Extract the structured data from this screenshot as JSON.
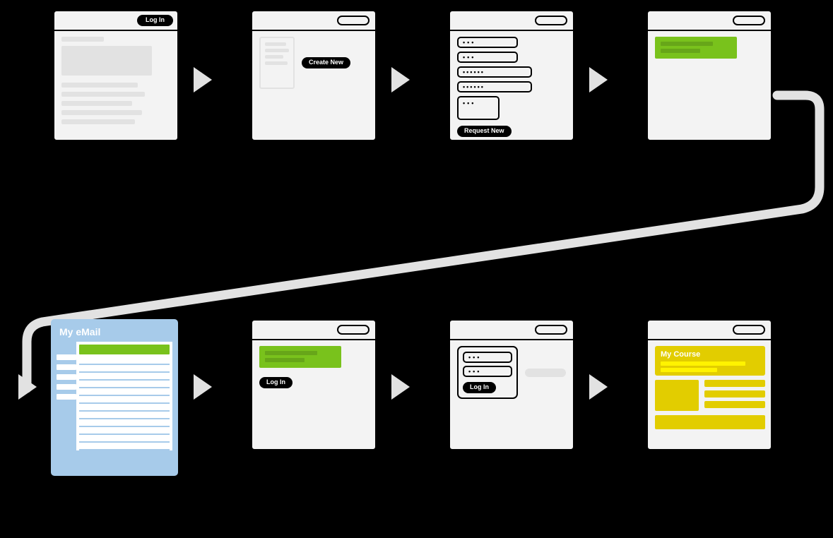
{
  "steps": {
    "s1": {
      "login_label": "Log In"
    },
    "s2": {
      "create_label": "Create New"
    },
    "s3": {
      "request_label": "Request New",
      "mask": "•••"
    },
    "s5": {
      "title": "My eMail"
    },
    "s6": {
      "login_label": "Log In"
    },
    "s7": {
      "login_label": "Log In",
      "mask": "•••"
    },
    "s8": {
      "title": "My Course"
    }
  }
}
